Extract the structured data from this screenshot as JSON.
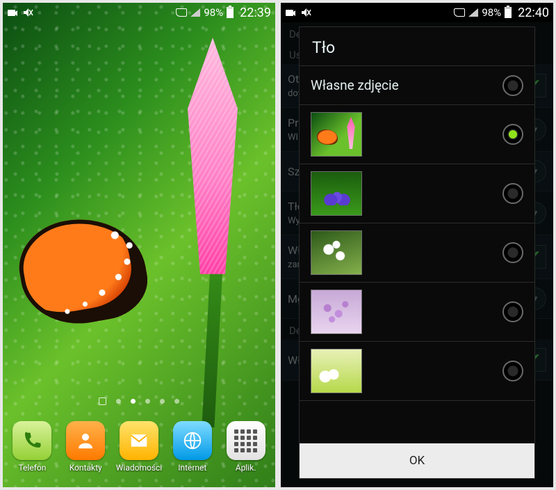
{
  "left": {
    "statusbar": {
      "battery_pct": "98%",
      "time": "22:39"
    },
    "dock": [
      {
        "name": "phone",
        "label": "Telefon"
      },
      {
        "name": "contacts",
        "label": "Kontakty"
      },
      {
        "name": "messages",
        "label": "Wiadomości"
      },
      {
        "name": "internet",
        "label": "Internet"
      },
      {
        "name": "apps",
        "label": "Aplik."
      }
    ],
    "page_count": 6,
    "active_page_index": 2
  },
  "right": {
    "statusbar": {
      "battery_pct": "98%",
      "time": "22:40"
    },
    "bg_settings": {
      "header1": "Deszcz",
      "header2": "Ustawien",
      "rows": [
        {
          "text": "Otw",
          "sub": "dotk",
          "ctrl": "check",
          "checked": true
        },
        {
          "text": "Prze",
          "sub": "WIĘC",
          "ctrl": "drop"
        },
        {
          "text": "Szyb",
          "ctrl": "drop"
        },
        {
          "text": "Tło",
          "sub": "Wyb",
          "ctrl": "drop"
        },
        {
          "text": "Włą",
          "sub": "zam",
          "ctrl": "check",
          "checked": true
        },
        {
          "text": "Mgł",
          "ctrl": "drop"
        }
      ],
      "header3": "Deszcz",
      "rows2": [
        {
          "text": "Włączyć /",
          "sub": "",
          "ctrl": "check",
          "checked": true
        }
      ]
    },
    "dialog": {
      "title": "Tło",
      "own_photo_label": "Własne zdjęcie",
      "options": [
        {
          "id": "own",
          "thumb": null,
          "selected": false
        },
        {
          "id": "butterfly",
          "thumb": "th-butterfly",
          "selected": true
        },
        {
          "id": "crocus",
          "thumb": "th-crocus",
          "selected": false
        },
        {
          "id": "white",
          "thumb": "th-white",
          "selected": false
        },
        {
          "id": "lilac",
          "thumb": "th-lilac",
          "selected": false
        },
        {
          "id": "plumeria",
          "thumb": "th-plum",
          "selected": false
        }
      ],
      "ok_label": "OK"
    }
  }
}
